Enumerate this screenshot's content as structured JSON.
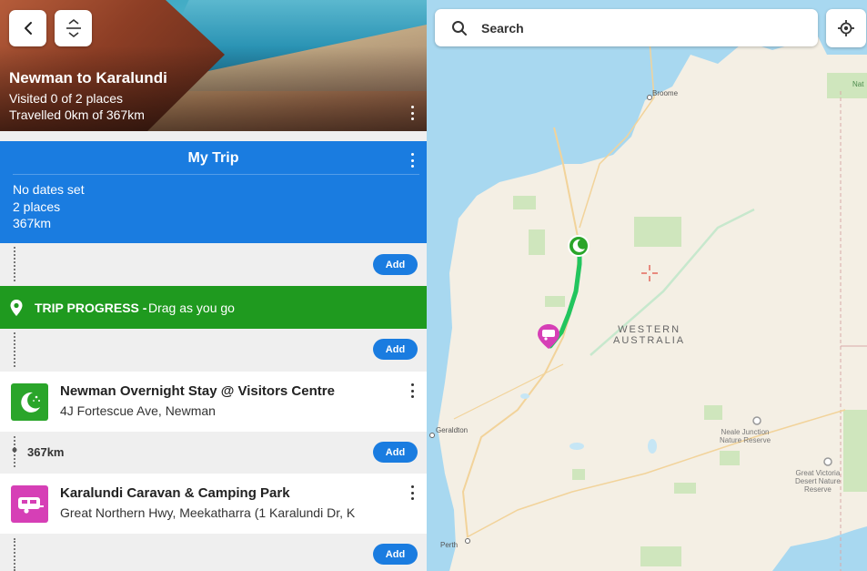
{
  "header": {
    "title": "Newman to Karalundi",
    "visited": "Visited 0 of 2 places",
    "travelled": "Travelled 0km of 367km"
  },
  "trip": {
    "title": "My Trip",
    "dates": "No dates set",
    "places": "2 places",
    "distance": "367km"
  },
  "add_label": "Add",
  "progress": {
    "label": "TRIP PROGRESS -",
    "hint": "Drag as you go"
  },
  "places": [
    {
      "name": "Newman Overnight Stay @ Visitors Centre",
      "address": "4J Fortescue Ave, Newman",
      "icon": "moon-stars-icon",
      "color": "#2aa52a"
    },
    {
      "name": "Karalundi Caravan & Camping Park",
      "address": "Great Northern Hwy, Meekatharra (1 Karalundi Dr, K",
      "icon": "caravan-icon",
      "color": "#d63fb6"
    }
  ],
  "leg_distance": "367km",
  "search": {
    "placeholder": "Search"
  },
  "map": {
    "labels": {
      "broome": "Broome",
      "geraldton": "Geraldton",
      "perth": "Perth",
      "region_line1": "WESTERN",
      "region_line2": "AUSTRALIA",
      "neale_1": "Neale Junction",
      "neale_2": "Nature Reserve",
      "gvd_1": "Great Victoria",
      "gvd_2": "Desert Nature",
      "gvd_3": "Reserve",
      "nat": "Nat"
    },
    "route_color": "#22c55e",
    "water_color": "#a8d8f0",
    "land_color": "#f4efe4"
  }
}
